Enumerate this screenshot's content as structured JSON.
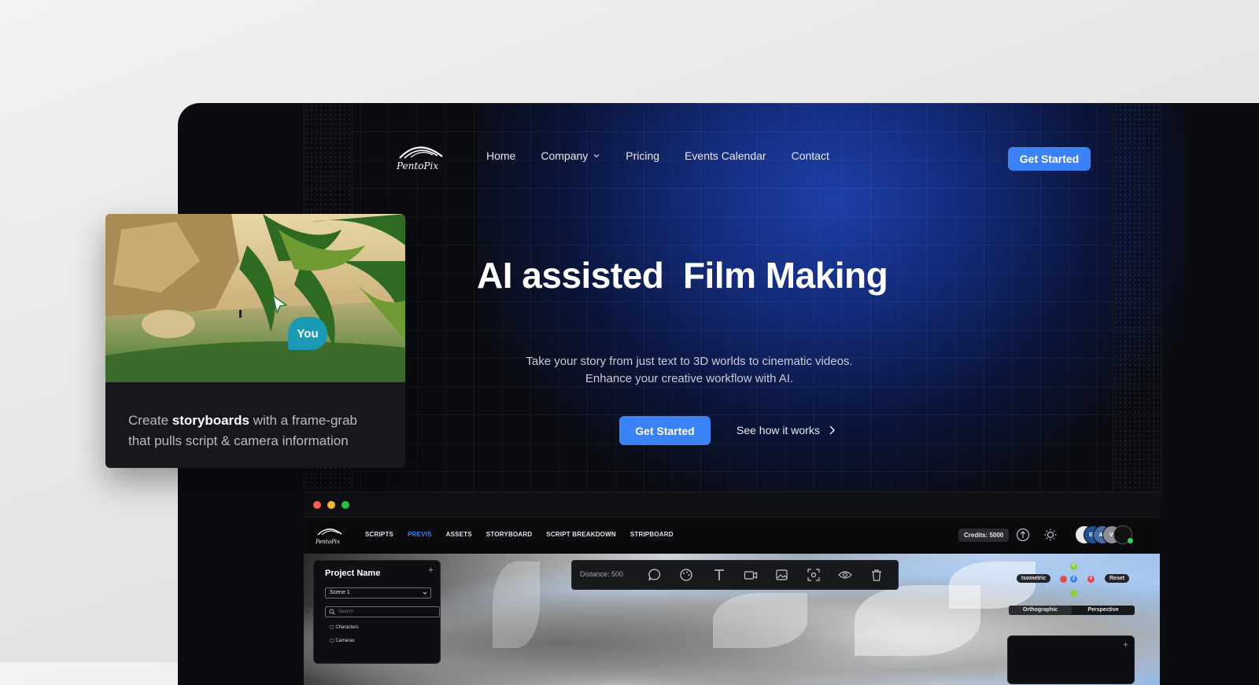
{
  "brand": {
    "logo_text": "PentoPix"
  },
  "nav": {
    "items": [
      {
        "label": "Home"
      },
      {
        "label": "Company",
        "has_dropdown": true
      },
      {
        "label": "Pricing"
      },
      {
        "label": "Events Calendar"
      },
      {
        "label": "Contact"
      }
    ],
    "cta_label": "Get Started"
  },
  "hero": {
    "title": "AI assisted  Film Making",
    "subtitle_line1": "Take your story from just text to 3D worlds to cinematic videos.",
    "subtitle_line2": "Enhance your creative workflow with AI.",
    "cta_label": "Get Started",
    "secondary_label": "See how it works"
  },
  "card": {
    "text_pre": "Create ",
    "text_bold": "storyboards",
    "text_post": " with a frame-grab that pulls script & camera information",
    "bubble_label": "You"
  },
  "app": {
    "logo_text": "PentoPix",
    "tabs": [
      {
        "label": "SCRIPTS",
        "active": false
      },
      {
        "label": "PREVIS",
        "active": true
      },
      {
        "label": "ASSETS",
        "active": false
      },
      {
        "label": "STORYBOARD",
        "active": false
      },
      {
        "label": "SCRIPT BREAKDOWN",
        "active": false
      },
      {
        "label": "STRIPBOARD",
        "active": false
      }
    ],
    "credits": "Credits: 5000",
    "avatars": [
      "I",
      "EB",
      "AF",
      "VI"
    ],
    "project_panel": {
      "title": "Project Name",
      "scene_select": "Scene 1",
      "search_placeholder": "Search",
      "items": [
        "Characters",
        "Cameras"
      ]
    },
    "toolbar": {
      "distance": "Distance: 500"
    },
    "view_controls": {
      "isometric": "Isometric",
      "reset": "Reset",
      "orthographic": "Orthographic",
      "perspective": "Perspective",
      "axes": [
        "Y",
        "Z",
        "X"
      ]
    }
  },
  "colors": {
    "accent": "#3b82f6",
    "bubble": "#1b9ab5",
    "traffic_red": "#ff5f57",
    "traffic_yellow": "#febc2e",
    "traffic_green": "#28c840"
  }
}
